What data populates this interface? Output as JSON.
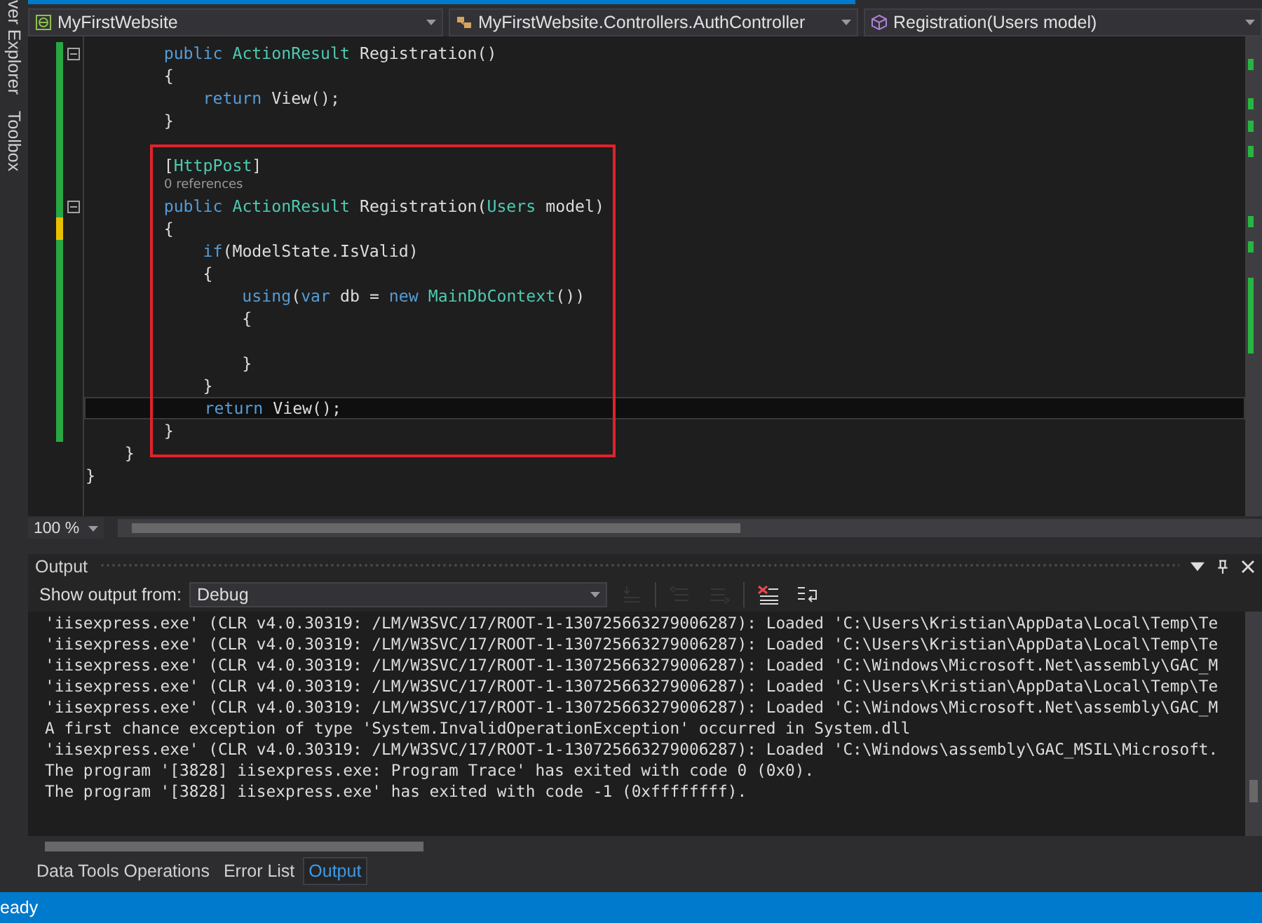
{
  "side_tabs": [
    "ver Explorer",
    "Toolbox"
  ],
  "navigation": [
    {
      "kind": "project",
      "text": "MyFirstWebsite"
    },
    {
      "kind": "class",
      "text": "MyFirstWebsite.Controllers.AuthController"
    },
    {
      "kind": "member",
      "text": "Registration(Users model)"
    }
  ],
  "editor": {
    "lines": [
      {
        "kind": "code",
        "collapsible": true,
        "changed": true,
        "saved": true,
        "boxed": false,
        "current": false,
        "tokens": [
          {
            "kind": "keyword",
            "text": "        public"
          },
          {
            "kind": "type",
            "text": " ActionResult"
          },
          {
            "kind": "plain",
            "text": " Registration()"
          }
        ]
      },
      {
        "kind": "code",
        "collapsible": false,
        "changed": true,
        "saved": true,
        "boxed": false,
        "current": false,
        "tokens": [
          {
            "kind": "plain",
            "text": "        {"
          }
        ]
      },
      {
        "kind": "code",
        "collapsible": false,
        "changed": true,
        "saved": true,
        "boxed": false,
        "current": false,
        "tokens": [
          {
            "kind": "keyword",
            "text": "            return"
          },
          {
            "kind": "plain",
            "text": " View();"
          }
        ]
      },
      {
        "kind": "code",
        "collapsible": false,
        "changed": true,
        "saved": true,
        "boxed": false,
        "current": false,
        "tokens": [
          {
            "kind": "plain",
            "text": "        }"
          }
        ]
      },
      {
        "kind": "blank",
        "collapsible": false,
        "changed": true,
        "saved": true,
        "boxed": false,
        "current": false
      },
      {
        "kind": "code",
        "collapsible": false,
        "changed": true,
        "saved": true,
        "boxed": true,
        "current": false,
        "tokens": [
          {
            "kind": "plain",
            "text": "        ["
          },
          {
            "kind": "type",
            "text": "HttpPost"
          },
          {
            "kind": "plain",
            "text": "]"
          }
        ]
      },
      {
        "kind": "codelens",
        "collapsible": false,
        "changed": true,
        "saved": true,
        "boxed": true,
        "current": false,
        "text": "0 references"
      },
      {
        "kind": "code",
        "collapsible": true,
        "changed": true,
        "saved": true,
        "boxed": true,
        "current": false,
        "tokens": [
          {
            "kind": "keyword",
            "text": "        public"
          },
          {
            "kind": "type",
            "text": " ActionResult"
          },
          {
            "kind": "plain",
            "text": " Registration("
          },
          {
            "kind": "type",
            "text": "Users"
          },
          {
            "kind": "plain",
            "text": " model)"
          }
        ]
      },
      {
        "kind": "code",
        "collapsible": false,
        "changed": true,
        "saved": false,
        "boxed": true,
        "current": false,
        "tokens": [
          {
            "kind": "plain",
            "text": "        {"
          }
        ]
      },
      {
        "kind": "code",
        "collapsible": false,
        "changed": true,
        "saved": true,
        "boxed": true,
        "current": false,
        "tokens": [
          {
            "kind": "keyword",
            "text": "            if"
          },
          {
            "kind": "plain",
            "text": "(ModelState.IsValid)"
          }
        ]
      },
      {
        "kind": "code",
        "collapsible": false,
        "changed": true,
        "saved": true,
        "boxed": true,
        "current": false,
        "tokens": [
          {
            "kind": "plain",
            "text": "            {"
          }
        ]
      },
      {
        "kind": "code",
        "collapsible": false,
        "changed": true,
        "saved": true,
        "boxed": true,
        "current": false,
        "tokens": [
          {
            "kind": "keyword",
            "text": "                using"
          },
          {
            "kind": "plain",
            "text": "("
          },
          {
            "kind": "keyword",
            "text": "var"
          },
          {
            "kind": "plain",
            "text": " db = "
          },
          {
            "kind": "keyword",
            "text": "new"
          },
          {
            "kind": "type",
            "text": " MainDbContext"
          },
          {
            "kind": "plain",
            "text": "())"
          }
        ]
      },
      {
        "kind": "code",
        "collapsible": false,
        "changed": true,
        "saved": true,
        "boxed": true,
        "current": false,
        "tokens": [
          {
            "kind": "plain",
            "text": "                {"
          }
        ]
      },
      {
        "kind": "blank",
        "collapsible": false,
        "changed": true,
        "saved": true,
        "boxed": true,
        "current": false
      },
      {
        "kind": "code",
        "collapsible": false,
        "changed": true,
        "saved": true,
        "boxed": true,
        "current": false,
        "tokens": [
          {
            "kind": "plain",
            "text": "                }"
          }
        ]
      },
      {
        "kind": "code",
        "collapsible": false,
        "changed": true,
        "saved": true,
        "boxed": true,
        "current": false,
        "tokens": [
          {
            "kind": "plain",
            "text": "            }"
          }
        ]
      },
      {
        "kind": "code",
        "collapsible": false,
        "changed": true,
        "saved": true,
        "boxed": true,
        "current": true,
        "tokens": [
          {
            "kind": "keyword",
            "text": "            return"
          },
          {
            "kind": "plain",
            "text": " View();"
          }
        ]
      },
      {
        "kind": "code",
        "collapsible": false,
        "changed": true,
        "saved": true,
        "boxed": true,
        "current": false,
        "tokens": [
          {
            "kind": "plain",
            "text": "        }"
          }
        ]
      },
      {
        "kind": "code",
        "collapsible": false,
        "changed": false,
        "boxed": false,
        "current": false,
        "tokens": [
          {
            "kind": "plain",
            "text": "    }"
          }
        ]
      },
      {
        "kind": "code",
        "collapsible": false,
        "changed": false,
        "boxed": false,
        "current": false,
        "tokens": [
          {
            "kind": "plain",
            "text": "}"
          }
        ]
      }
    ],
    "zoom": "100 %"
  },
  "output": {
    "title": "Output",
    "source_label": "Show output from:",
    "source": "Debug",
    "toolbar": [
      {
        "kind": "go-to",
        "disabled": true
      },
      {
        "kind": "previous",
        "disabled": true
      },
      {
        "kind": "next",
        "disabled": true
      },
      {
        "kind": "clear",
        "disabled": false
      },
      {
        "kind": "wrap",
        "disabled": false
      }
    ],
    "lines": [
      "'iisexpress.exe' (CLR v4.0.30319: /LM/W3SVC/17/ROOT-1-130725663279006287): Loaded 'C:\\Users\\Kristian\\AppData\\Local\\Temp\\Te",
      "'iisexpress.exe' (CLR v4.0.30319: /LM/W3SVC/17/ROOT-1-130725663279006287): Loaded 'C:\\Users\\Kristian\\AppData\\Local\\Temp\\Te",
      "'iisexpress.exe' (CLR v4.0.30319: /LM/W3SVC/17/ROOT-1-130725663279006287): Loaded 'C:\\Windows\\Microsoft.Net\\assembly\\GAC_M",
      "'iisexpress.exe' (CLR v4.0.30319: /LM/W3SVC/17/ROOT-1-130725663279006287): Loaded 'C:\\Users\\Kristian\\AppData\\Local\\Temp\\Te",
      "'iisexpress.exe' (CLR v4.0.30319: /LM/W3SVC/17/ROOT-1-130725663279006287): Loaded 'C:\\Windows\\Microsoft.Net\\assembly\\GAC_M",
      "A first chance exception of type 'System.InvalidOperationException' occurred in System.dll",
      "'iisexpress.exe' (CLR v4.0.30319: /LM/W3SVC/17/ROOT-1-130725663279006287): Loaded 'C:\\Windows\\assembly\\GAC_MSIL\\Microsoft.",
      "The program '[3828] iisexpress.exe: Program Trace' has exited with code 0 (0x0).",
      "The program '[3828] iisexpress.exe' has exited with code -1 (0xffffffff)."
    ]
  },
  "bottom_tabs": [
    {
      "label": "Data Tools Operations",
      "selected": false
    },
    {
      "label": "Error List",
      "selected": false
    },
    {
      "label": "Output",
      "selected": true
    }
  ],
  "status_bar": {
    "text": "eady"
  }
}
